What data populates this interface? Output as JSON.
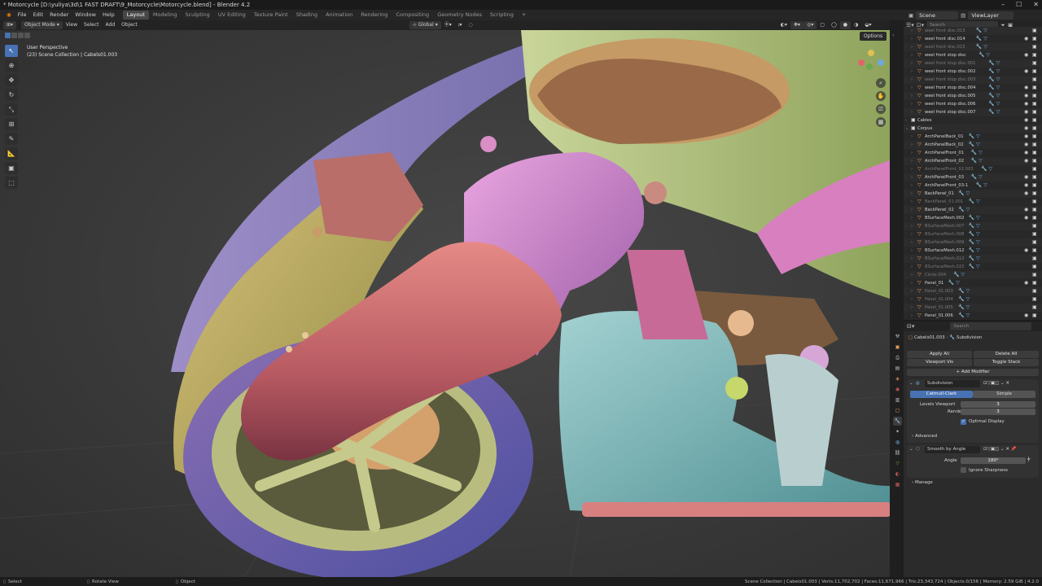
{
  "title": "* Motorcycle [D:\\yuliya\\3d\\1 FAST DRAFT\\9_Motorcycle\\Motorcycle.blend] - Blender 4.2",
  "menu": [
    "File",
    "Edit",
    "Render",
    "Window",
    "Help"
  ],
  "workspaces": [
    "Layout",
    "Modeling",
    "Sculpting",
    "UV Editing",
    "Texture Paint",
    "Shading",
    "Animation",
    "Rendering",
    "Compositing",
    "Geometry Nodes",
    "Scripting"
  ],
  "workspace_add": "+",
  "scene": "Scene",
  "view_layer": "ViewLayer",
  "viewport_header": {
    "mode": "Object Mode",
    "menus": [
      "View",
      "Select",
      "Add",
      "Object"
    ],
    "transform": "Global"
  },
  "viewport": {
    "perspective": "User Perspective",
    "collection_info": "(23) Scene Collection | Cabels01.003",
    "options": "Options"
  },
  "outliner": {
    "search_placeholder": "Search",
    "rows": [
      {
        "name": "weel front disc.013",
        "dim": true
      },
      {
        "name": "weel front disc.014",
        "dim": false
      },
      {
        "name": "weel front disc.015",
        "dim": true
      },
      {
        "name": "weel front stop disc",
        "dim": false
      },
      {
        "name": "weel front stop disc.001",
        "dim": true
      },
      {
        "name": "weel front stop disc.002",
        "dim": false
      },
      {
        "name": "weel front stop disc.003",
        "dim": true
      },
      {
        "name": "weel front stop disc.004",
        "dim": false
      },
      {
        "name": "weel front stop disc.005",
        "dim": false
      },
      {
        "name": "weel front stop disc.006",
        "dim": false
      },
      {
        "name": "weel front stop disc.007",
        "dim": false
      },
      {
        "name": "Cables",
        "dim": false,
        "collection": true
      },
      {
        "name": "Corpus",
        "dim": false,
        "collection": true,
        "open": true
      },
      {
        "name": "ArchPanelBack_01",
        "dim": false
      },
      {
        "name": "ArchPanelBack_02",
        "dim": false
      },
      {
        "name": "ArchPanelFront_01",
        "dim": false
      },
      {
        "name": "ArchPanelFront_02",
        "dim": false
      },
      {
        "name": "ArchPanelFront_02.003",
        "dim": true
      },
      {
        "name": "ArchPanelFront_03",
        "dim": false
      },
      {
        "name": "ArchPanelFront_03-1",
        "dim": false
      },
      {
        "name": "BackPanel_01",
        "dim": false
      },
      {
        "name": "BackPanel_01.001",
        "dim": true
      },
      {
        "name": "BackPanel_02",
        "dim": false
      },
      {
        "name": "BSurfaceMesh.002",
        "dim": false
      },
      {
        "name": "BSurfaceMesh.007",
        "dim": true
      },
      {
        "name": "BSurfaceMesh.008",
        "dim": true
      },
      {
        "name": "BSurfaceMesh.009",
        "dim": true
      },
      {
        "name": "BSurfaceMesh.012",
        "dim": false
      },
      {
        "name": "BSurfaceMesh.013",
        "dim": true
      },
      {
        "name": "BSurfaceMesh.015",
        "dim": true
      },
      {
        "name": "Circle.004",
        "dim": true
      },
      {
        "name": "Panel_01",
        "dim": false
      },
      {
        "name": "Panel_01.003",
        "dim": true
      },
      {
        "name": "Panel_01.004",
        "dim": true
      },
      {
        "name": "Panel_01.005",
        "dim": true
      },
      {
        "name": "Panel_01.006",
        "dim": false
      }
    ]
  },
  "properties": {
    "search_placeholder": "Search",
    "object": "Cabels01.003",
    "modifier_context": "Subdivision",
    "apply_all": "Apply All",
    "delete_all": "Delete All",
    "viewport_vis": "Viewport Vis",
    "toggle_stack": "Toggle Stack",
    "add_modifier": "Add Modifier",
    "subdivision": {
      "name": "Subdivision",
      "catmull_clark": "Catmull-Clark",
      "simple": "Simple",
      "levels_viewport_label": "Levels Viewport",
      "levels_viewport": "3",
      "render_label": "Render",
      "render": "3",
      "optimal_display": "Optimal Display",
      "advanced": "Advanced"
    },
    "smooth": {
      "name": "Smooth by Angle",
      "angle_label": "Angle",
      "angle": "180°",
      "ignore_sharpness": "Ignore Sharpness"
    },
    "manage": "Manage"
  },
  "status": {
    "select": "Select",
    "rotate_view": "Rotate View",
    "object": "Object",
    "stats": "Scene Collection | Cabels01.003 | Verts:11,702,702 | Faces:11,671,966 | Tris:23,343,724 | Objects:0/156 | Memory: 2.59 GiB | 4.2.0"
  }
}
